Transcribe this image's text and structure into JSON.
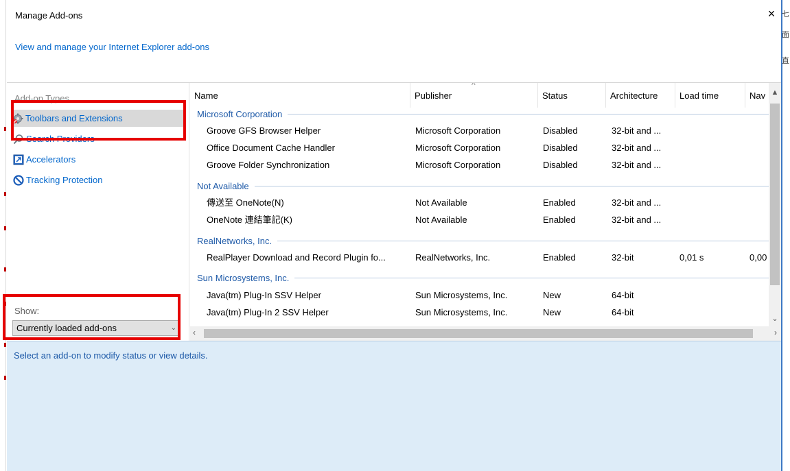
{
  "window": {
    "title": "Manage Add-ons",
    "close_glyph": "×",
    "subtitle": "View and manage your Internet Explorer add-ons"
  },
  "right_edge_glyphs": [
    "七",
    "面",
    "直"
  ],
  "sidebar": {
    "types_label": "Add-on Types",
    "items": [
      {
        "label": "Toolbars and Extensions",
        "icon": "gear-icon",
        "selected": true
      },
      {
        "label": "Search Providers",
        "icon": "search-icon",
        "selected": false
      },
      {
        "label": "Accelerators",
        "icon": "accelerator-icon",
        "selected": false
      },
      {
        "label": "Tracking Protection",
        "icon": "tracking-protection-icon",
        "selected": false
      }
    ],
    "show_label": "Show:",
    "show_value": "Currently loaded add-ons"
  },
  "table": {
    "columns": [
      "Name",
      "Publisher",
      "Status",
      "Architecture",
      "Load time",
      "Nav"
    ],
    "groups": [
      {
        "name": "Microsoft Corporation",
        "rows": [
          {
            "name": "Groove GFS Browser Helper",
            "publisher": "Microsoft Corporation",
            "status": "Disabled",
            "architecture": "32-bit and ...",
            "load_time": "",
            "nav": ""
          },
          {
            "name": "Office Document Cache Handler",
            "publisher": "Microsoft Corporation",
            "status": "Disabled",
            "architecture": "32-bit and ...",
            "load_time": "",
            "nav": ""
          },
          {
            "name": "Groove Folder Synchronization",
            "publisher": "Microsoft Corporation",
            "status": "Disabled",
            "architecture": "32-bit and ...",
            "load_time": "",
            "nav": ""
          }
        ]
      },
      {
        "name": "Not Available",
        "rows": [
          {
            "name": "傳送至 OneNote(N)",
            "publisher": "Not Available",
            "status": "Enabled",
            "architecture": "32-bit and ...",
            "load_time": "",
            "nav": ""
          },
          {
            "name": "OneNote 連結筆記(K)",
            "publisher": "Not Available",
            "status": "Enabled",
            "architecture": "32-bit and ...",
            "load_time": "",
            "nav": ""
          }
        ]
      },
      {
        "name": "RealNetworks, Inc.",
        "rows": [
          {
            "name": "RealPlayer Download and Record Plugin fo...",
            "publisher": "RealNetworks, Inc.",
            "status": "Enabled",
            "architecture": "32-bit",
            "load_time": "0,01 s",
            "nav": "0,00"
          }
        ]
      },
      {
        "name": "Sun Microsystems, Inc.",
        "rows": [
          {
            "name": "Java(tm) Plug-In SSV Helper",
            "publisher": "Sun Microsystems, Inc.",
            "status": "New",
            "architecture": "64-bit",
            "load_time": "",
            "nav": ""
          },
          {
            "name": "Java(tm) Plug-In 2 SSV Helper",
            "publisher": "Sun Microsystems, Inc.",
            "status": "New",
            "architecture": "64-bit",
            "load_time": "",
            "nav": ""
          }
        ]
      }
    ]
  },
  "details": {
    "text": "Select an add-on to modify status or view details."
  },
  "colors": {
    "link_blue": "#0066cc",
    "group_blue": "#1e5aa8",
    "highlight_red": "#e60000",
    "details_bg": "#ddecf8"
  }
}
